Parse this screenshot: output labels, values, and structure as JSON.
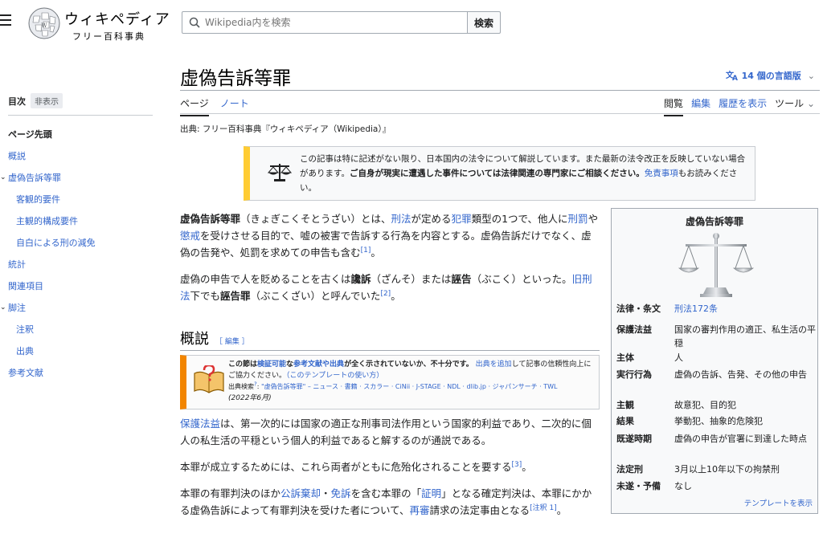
{
  "header": {
    "logo_name": "ウィキペディア",
    "logo_tagline": "フリー百科事典",
    "search_placeholder": "Wikipedia内を検索",
    "search_button": "検索"
  },
  "toc": {
    "title": "目次",
    "hide": "非表示",
    "items": [
      {
        "label": "ページ先頭",
        "level": "top"
      },
      {
        "label": "概説",
        "level": "1"
      },
      {
        "label": "虚偽告訴等罪",
        "level": "1",
        "expanded": true
      },
      {
        "label": "客観的要件",
        "level": "2"
      },
      {
        "label": "主観的構成要件",
        "level": "2"
      },
      {
        "label": "自白による刑の減免",
        "level": "2"
      },
      {
        "label": "統計",
        "level": "1"
      },
      {
        "label": "関連項目",
        "level": "1"
      },
      {
        "label": "脚注",
        "level": "1",
        "expanded": true
      },
      {
        "label": "注釈",
        "level": "2"
      },
      {
        "label": "出典",
        "level": "2"
      },
      {
        "label": "参考文献",
        "level": "1"
      }
    ]
  },
  "page": {
    "title": "虚偽告訴等罪",
    "languages": "14 個の言語版",
    "tabs_left": [
      "ページ",
      "ノート"
    ],
    "tabs_right": [
      "閲覧",
      "編集",
      "履歴を表示",
      "ツール"
    ],
    "source": "出典: フリー百科事典『ウィキペディア（Wikipedia）』"
  },
  "notice": {
    "text1": "この記事は特に記述がない限り、日本国内の法令について解説しています。また最新の法令改正を反映していない場合があります。",
    "text2": "ご自身が現実に遭遇した事件については法律関連の専門家にご相談ください。",
    "link": "免責事項",
    "text3": "もお読みください。"
  },
  "intro": {
    "p1_bold": "虚偽告訴等罪",
    "p1_a": "（きょぎこくそとうざい）とは、",
    "p1_link1": "刑法",
    "p1_b": "が定める",
    "p1_link2": "犯罪",
    "p1_c": "類型の1つで、他人に",
    "p1_link3": "刑罰",
    "p1_d": "や",
    "p1_link4": "懲戒",
    "p1_e": "を受けさせる目的で、嘘の被害で告訴する行為を内容とする。虚偽告訴だけでなく、虚偽の告発や、処罰を求めての申告も含む",
    "p1_ref": "[1]",
    "p1_f": "。",
    "p2_a": "虚偽の申告で人を貶めることを古くは",
    "p2_bold1": "讒訴",
    "p2_b": "（ざんそ）または",
    "p2_bold2": "誣告",
    "p2_c": "（ぶこく）といった。",
    "p2_link": "旧刑法",
    "p2_d": "下でも",
    "p2_bold3": "誣告罪",
    "p2_e": "（ぶこくざい）と呼んでいた",
    "p2_ref": "[2]",
    "p2_f": "。"
  },
  "section": {
    "heading": "概説",
    "edit": "［ 編集 ］",
    "notice_bold1": "この節は",
    "notice_link1": "検証可能",
    "notice_bold2": "な",
    "notice_link2": "参考文献や出典",
    "notice_bold3": "が全く示されていないか、不十分です。",
    "notice_link3": "出典を追加",
    "notice_rest": "して記事の信頼性向上にご協力ください。",
    "notice_usage": "（このテンプレートの使い方）",
    "notice_search_label": "出典検索",
    "notice_search_sup": "?",
    "notice_search_terms": "\"虚偽告訴等罪\" – ニュース · 書籍 · スカラー · CiNii · J-STAGE · NDL · dlib.jp · ジャパンサーチ · TWL",
    "notice_date": "(2022年6月)",
    "p1_link": "保護法益",
    "p1_rest": "は、第一次的には国家の適正な刑事司法作用という国家的利益であり、二次的に個人の私生活の平穏という個人的利益であると解するのが通説である。",
    "p2": "本罪が成立するためには、これら両者がともに危殆化されることを要する",
    "p2_ref": "[3]",
    "p2_end": "。",
    "p3_a": "本罪の有罪判決のほか",
    "p3_link1": "公訴棄却",
    "p3_b": "・",
    "p3_link2": "免訴",
    "p3_c": "を含む本罪の「",
    "p3_link3": "証明",
    "p3_d": "」となる確定判決は、本罪にかかる虚偽告訴によって有罪判決を受けた者について、",
    "p3_link4": "再審",
    "p3_e": "請求の法定事由となる",
    "p3_ref": "[注釈 1]",
    "p3_f": "。"
  },
  "infobox": {
    "title": "虚偽告訴等罪",
    "rows": [
      {
        "label": "法律・条文",
        "value": "刑法172条",
        "link": true
      },
      {
        "label": "保護法益",
        "value": "国家の審判作用の適正、私生活の平穏"
      },
      {
        "label": "主体",
        "value": "人"
      },
      {
        "label": "実行行為",
        "value": "虚偽の告訴、告発、その他の申告"
      },
      {
        "label": "主観",
        "value": "故意犯、目的犯"
      },
      {
        "label": "結果",
        "value": "挙動犯、抽象的危険犯"
      },
      {
        "label": "既遂時期",
        "value": "虚偽の申告が官署に到達した時点"
      },
      {
        "label": "法定刑",
        "value": "3月以上10年以下の拘禁刑"
      },
      {
        "label": "未遂・予備",
        "value": "なし"
      }
    ],
    "template_link": "テンプレートを表示"
  },
  "colors": {
    "link": "#3366cc",
    "notice_border": "#ffcc33",
    "section_notice_border": "#f28500"
  }
}
